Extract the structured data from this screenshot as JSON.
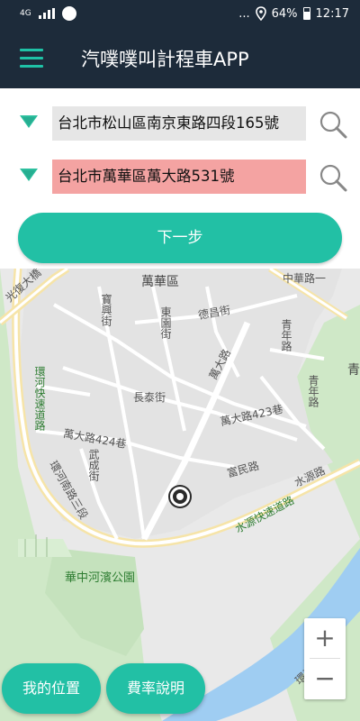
{
  "status_bar": {
    "network": "4G",
    "dots": "...",
    "battery": "64%",
    "time": "12:17",
    "icons": [
      "signal-icon",
      "notification-circle-icon",
      "location-pin-icon",
      "battery-icon"
    ]
  },
  "app_bar": {
    "title": "汽噗噗叫計程車APP",
    "menu_icon": "hamburger-menu-icon"
  },
  "form": {
    "origin_value": "台北市松山區南京東路四段165號",
    "destination_value": "台北市萬華區萬大路531號",
    "next_button_label": "下一步",
    "dropdown_icon": "triangle-down-icon",
    "search_icon": "magnifier-icon"
  },
  "map": {
    "labels": {
      "district": "萬華區",
      "zhonghua": "中華路一",
      "guangfu_bridge": "光復大橋",
      "baoxing": "寶興街",
      "dongyuan": "東園街",
      "dexing": "德昌街",
      "qingnian": "青年路",
      "qing": "青",
      "huanhe_express": "環河快速道路",
      "changtai": "長泰街",
      "wanda_rd": "萬大路",
      "wanda_423": "萬大路423巷",
      "wanda_424": "萬大路424巷",
      "qingnian_road": "青年路",
      "wucheng": "武成街",
      "huanhe_south": "環河南路三段",
      "fumin": "富民路",
      "shuiyuan": "水源路",
      "shuiyuan_express": "水源快速道路",
      "huazhong_park": "華中河濱公園",
      "huanhe_south_1": "環河南路一"
    },
    "zoom_in": "+",
    "zoom_out": "−",
    "my_location_label": "我的位置",
    "fare_label": "費率說明"
  }
}
